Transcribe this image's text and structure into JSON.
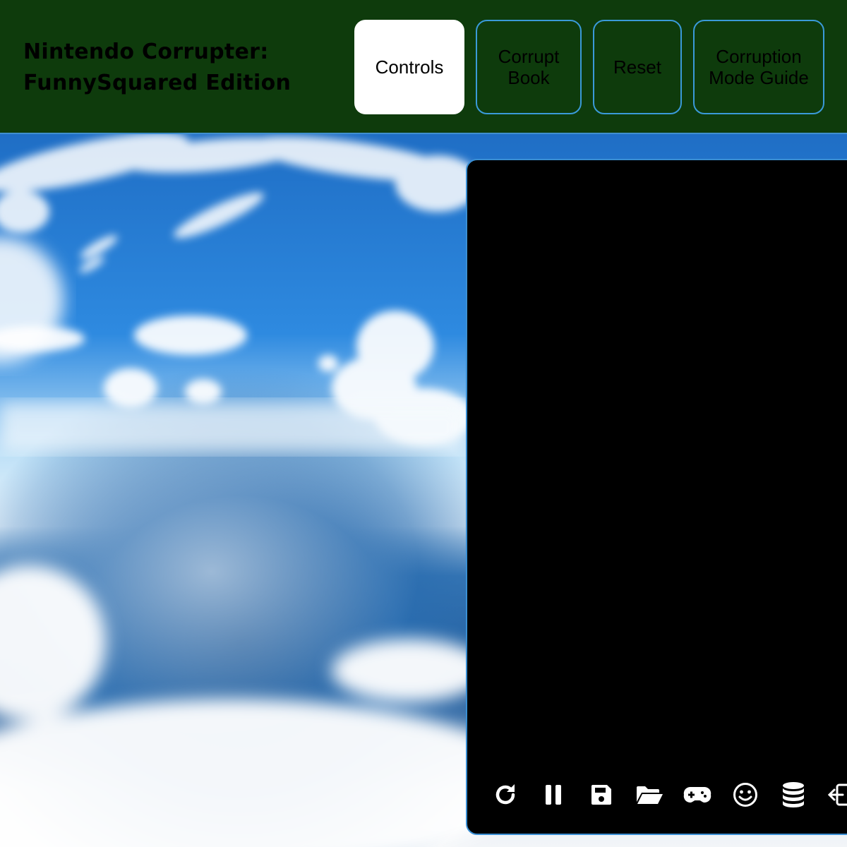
{
  "header": {
    "title": "Nintendo Corrupter: FunnySquared Edition",
    "nav": [
      {
        "label": "Controls",
        "active": true
      },
      {
        "label": "Corrupt Book",
        "active": false
      },
      {
        "label": "Reset",
        "active": false
      },
      {
        "label": "Corruption Mode Guide",
        "active": false
      }
    ]
  },
  "emulator": {
    "toolbar_icons": [
      "restart-icon",
      "pause-icon",
      "save-state-icon",
      "load-state-icon",
      "gamepad-icon",
      "cheats-smiley-icon",
      "database-icon",
      "exit-icon"
    ]
  },
  "colors": {
    "header_bg": "#0e3b0c",
    "accent_border": "#3a9ad9",
    "screen_bg": "#000000",
    "active_button_bg": "#ffffff"
  }
}
